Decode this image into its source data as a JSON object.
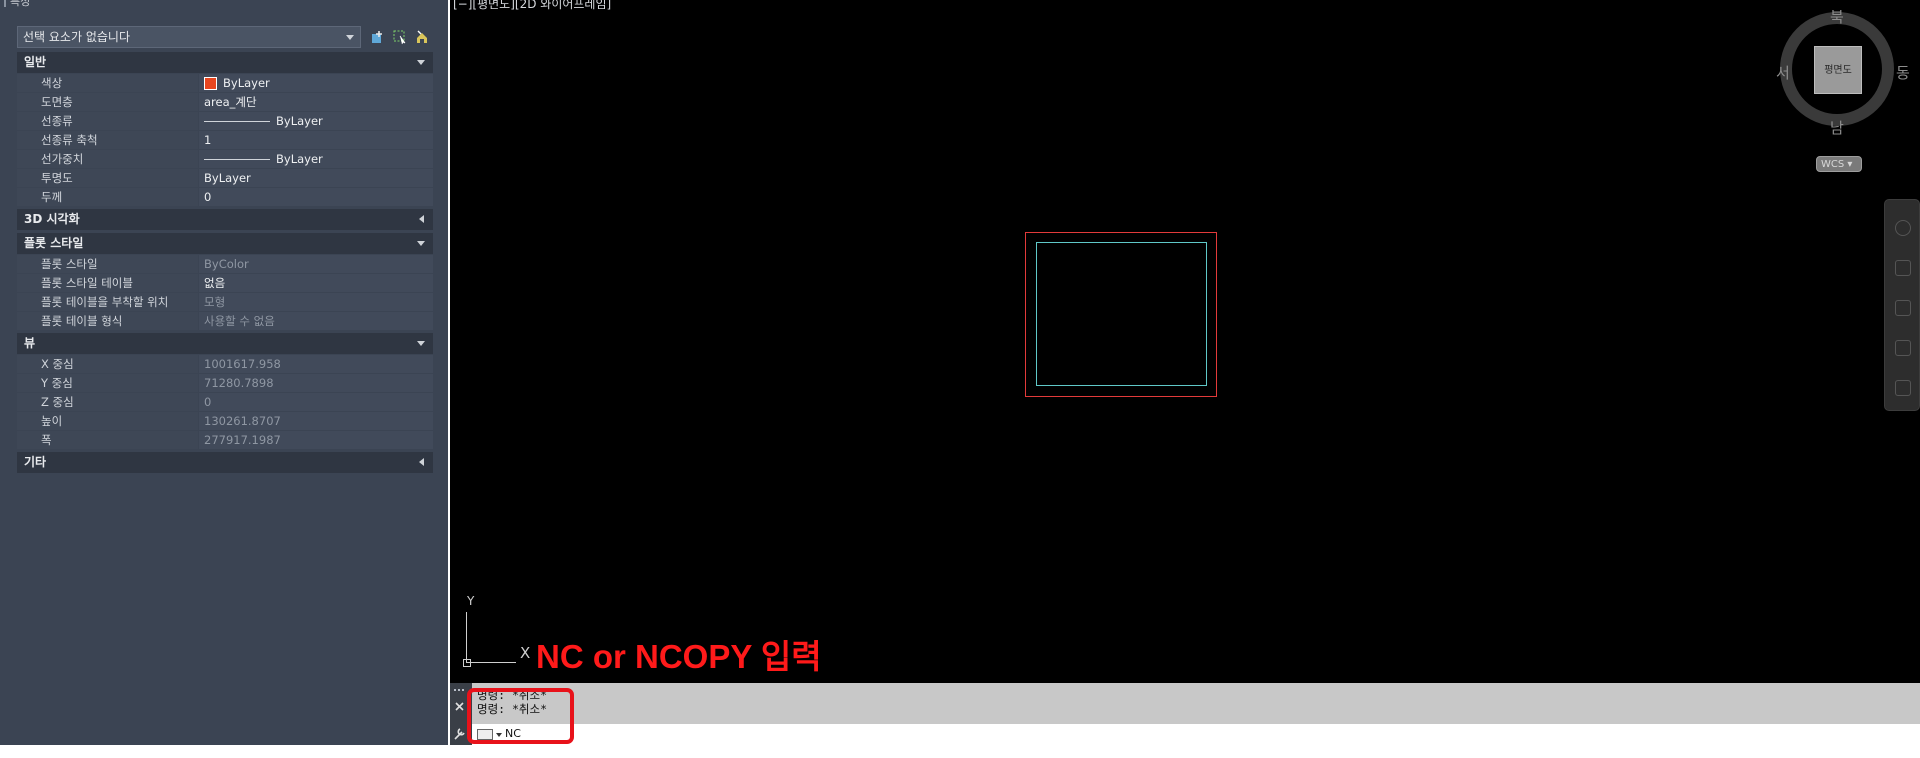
{
  "palette": {
    "title": "특성",
    "selection": "선택 요소가 없습니다",
    "sections": {
      "general": {
        "label": "일반",
        "rows": [
          {
            "key": "색상",
            "value": "ByLayer"
          },
          {
            "key": "도면층",
            "value": "area_계단"
          },
          {
            "key": "선종류",
            "value": "ByLayer"
          },
          {
            "key": "선종류 축척",
            "value": "1"
          },
          {
            "key": "선가중치",
            "value": "ByLayer"
          },
          {
            "key": "투명도",
            "value": "ByLayer"
          },
          {
            "key": "두께",
            "value": "0"
          }
        ]
      },
      "viz3d": {
        "label": "3D 시각화"
      },
      "plot_style": {
        "label": "플롯 스타일",
        "rows": [
          {
            "key": "플롯 스타일",
            "value": "ByColor"
          },
          {
            "key": "플롯 스타일 테이블",
            "value": "없음"
          },
          {
            "key": "플롯 테이블을 부착할 위치",
            "value": "모형"
          },
          {
            "key": "플롯 테이블 형식",
            "value": "사용할 수 없음"
          }
        ]
      },
      "view": {
        "label": "뷰",
        "rows": [
          {
            "key": "X 중심",
            "value": "1001617.958"
          },
          {
            "key": "Y 중심",
            "value": "71280.7898"
          },
          {
            "key": "Z 중심",
            "value": "0"
          },
          {
            "key": "높이",
            "value": "130261.8707"
          },
          {
            "key": "폭",
            "value": "277917.1987"
          }
        ]
      },
      "misc": {
        "label": "기타"
      }
    },
    "color_swatch": "#e8461f"
  },
  "viewport": {
    "view_label": "[−][평면도][2D 와이어프레임]",
    "viewcube": {
      "face": "평면도",
      "north": "북",
      "south": "남",
      "east": "동",
      "west": "서"
    },
    "wcs": "WCS ▾",
    "ucs": {
      "x": "X",
      "y": "Y"
    },
    "annotation": "NC or NCOPY 입력",
    "annotation_color": "#ff1a1a"
  },
  "command": {
    "history": [
      "명령: *취소*",
      "명령: *취소*"
    ],
    "input": "NC"
  }
}
